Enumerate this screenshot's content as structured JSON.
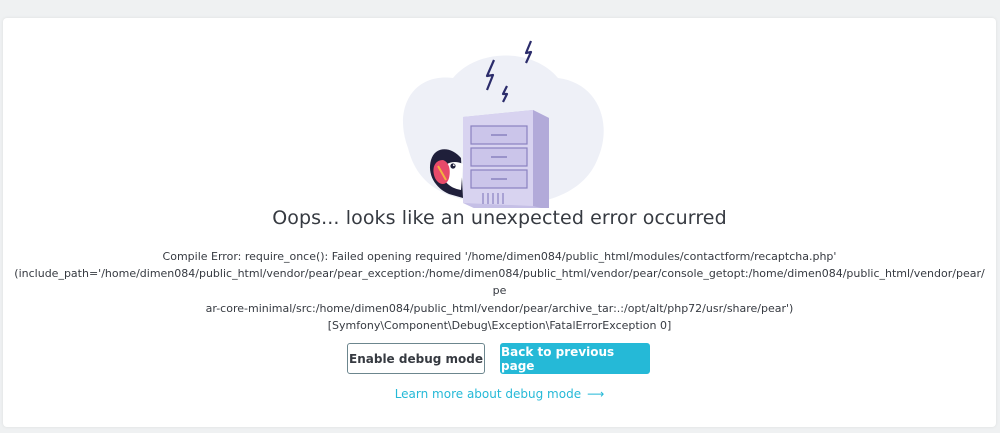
{
  "page": {
    "title": "Oops... looks like an unexpected error occurred",
    "message_lines": [
      "Compile Error: require_once(): Failed opening required '/home/dimen084/public_html/modules/contactform/recaptcha.php'",
      "(include_path='/home/dimen084/public_html/vendor/pear/pear_exception:/home/dimen084/public_html/vendor/pear/console_getopt:/home/dimen084/public_html/vendor/pear/pe",
      "ar-core-minimal/src:/home/dimen084/public_html/vendor/pear/archive_tar:.:/opt/alt/php72/usr/share/pear')",
      "[Symfony\\Component\\Debug\\Exception\\FatalErrorException 0]"
    ]
  },
  "actions": {
    "enable_debug_label": "Enable debug mode",
    "back_label": "Back to previous page",
    "learn_more_label": "Learn more about debug mode",
    "learn_more_arrow": "⟶"
  },
  "colors": {
    "accent": "#25b9d7",
    "text": "#363a41",
    "server": "#c5bfe6",
    "blob": "#eef0f7",
    "bolt": "#2b2c6b"
  },
  "icons": {
    "illustration": "server-error-illustration",
    "bolt": "lightning-bolt-icon",
    "mascot": "puffin-mascot-icon",
    "arrow": "arrow-right-icon"
  }
}
